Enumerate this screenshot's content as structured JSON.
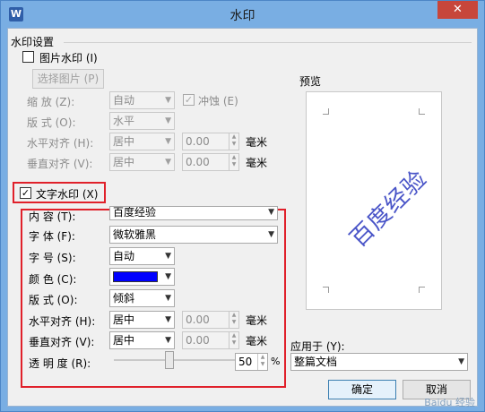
{
  "window": {
    "title": "水印",
    "app_icon": "W",
    "close_glyph": "✕"
  },
  "watermark_settings": {
    "group_label": "水印设置",
    "picture": {
      "checkbox_label": "图片水印 (I)",
      "choose_button": "选择图片 (P)",
      "scale_label": "缩    放 (Z):",
      "scale_value": "自动",
      "washout_label": "冲蚀 (E)",
      "layout_label": "版    式 (O):",
      "layout_value": "水平",
      "halign_label": "水平对齐 (H):",
      "halign_value": "居中",
      "halign_offset": "0.00",
      "valign_label": "垂直对齐 (V):",
      "valign_value": "居中",
      "valign_offset": "0.00",
      "unit": "毫米"
    },
    "text": {
      "checkbox_label": "文字水印 (X)",
      "content_label": "内    容 (T):",
      "content_value": "百度经验",
      "font_label": "字    体 (F):",
      "font_value": "微软雅黑",
      "size_label": "字    号 (S):",
      "size_value": "自动",
      "color_label": "颜    色 (C):",
      "color_value": "#0000ff",
      "layout_label": "版    式 (O):",
      "layout_value": "倾斜",
      "halign_label": "水平对齐 (H):",
      "halign_value": "居中",
      "halign_offset": "0.00",
      "valign_label": "垂直对齐 (V):",
      "valign_value": "居中",
      "valign_offset": "0.00",
      "unit": "毫米",
      "transparency_label": "透 明 度 (R):",
      "transparency_value": "50",
      "transparency_unit": "%"
    }
  },
  "preview": {
    "label": "预览",
    "watermark_text": "百度经验"
  },
  "apply_to": {
    "label": "应用于 (Y):",
    "value": "整篇文档"
  },
  "buttons": {
    "ok": "确定",
    "cancel": "取消"
  },
  "footer_watermark": "Baidu 经验"
}
